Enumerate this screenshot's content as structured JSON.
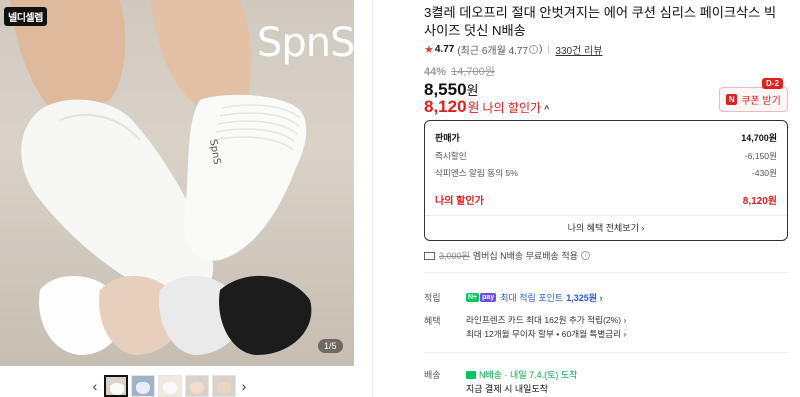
{
  "gallery": {
    "tag": "넬디셀렙",
    "brand_logo": "SpnS",
    "brand_mark": "®",
    "sock_print": "SpnS",
    "counter": "1/5",
    "prev_label": "‹",
    "next_label": "›",
    "thumb_count": 6
  },
  "product": {
    "title": "3켤레 데오프리 절대 안벗겨지는 에어 쿠션 심리스 페이크삭스 빅사이즈 덧신 N배송",
    "rating": "4.77",
    "rating_detail": "(최근 6개월 4.77",
    "rating_close": ")",
    "review_count": "330건 리뷰"
  },
  "price": {
    "discount": "44%",
    "original": "14,700원",
    "sale": "8,550",
    "won": "원",
    "my_price": "8,120",
    "my_price_label": "나의 할인가",
    "coupon_label": "쿠폰 받기",
    "coupon_badge": "N",
    "dday": "D-2"
  },
  "breakdown": {
    "rows": [
      {
        "label": "판매가",
        "value": "14,700원"
      },
      {
        "label": "즉시할인",
        "value": "-6,150원"
      },
      {
        "label": "삭피엔스 알림 동의 5%",
        "value": "-430원"
      }
    ],
    "mine_label": "나의 할인가",
    "mine_value": "8,120원",
    "all_benefits": "나의 혜택 전체보기 ›"
  },
  "shipping": {
    "old_fee": "3,000원",
    "text": "멤버십 N배송 무료배송 적용",
    "info": "i"
  },
  "points": {
    "label": "적립",
    "badge_n": "N+",
    "badge_p": "pay",
    "text": "최대 적립 포인트",
    "amount": "1,325원 ›"
  },
  "benefits": {
    "label": "혜택",
    "line1": "라인프렌즈 카드 최대 162원 추가 적립(2%) ›",
    "line2": "최대 12개월 무이자 할부 • 60개월 특별금리 ›"
  },
  "delivery": {
    "label": "배송",
    "line1": "N배송 · 내일 7.4.(토) 도착",
    "line2": "지금 결제 시 내일도착"
  }
}
